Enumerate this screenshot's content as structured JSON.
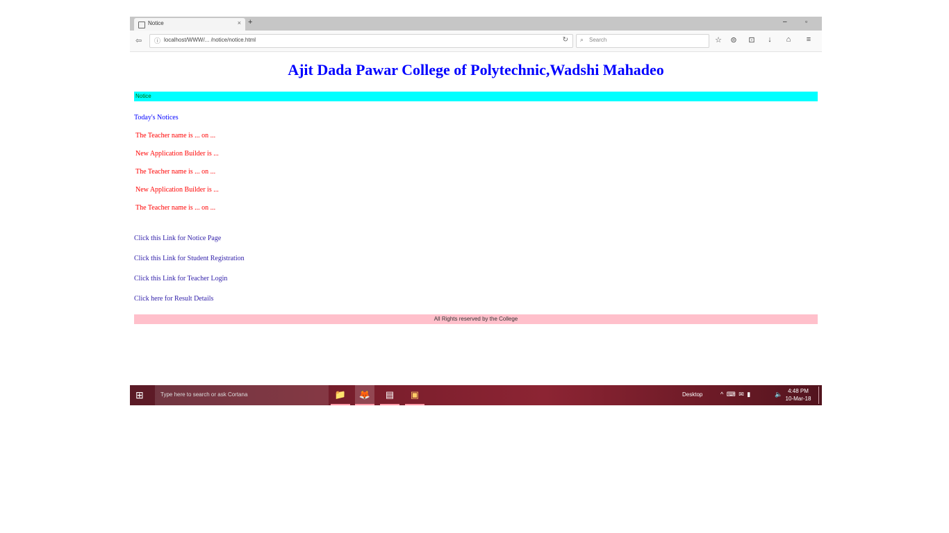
{
  "browser": {
    "tab_title": "Notice",
    "tab_close": "×",
    "new_tab": "+",
    "win_minimize": "–",
    "win_maximize": "▫",
    "back": "⇦",
    "info": "ⓘ",
    "url": "localhost/WWW/... /notice/notice.html",
    "reload": "↻",
    "search_icon": "⌕",
    "search_placeholder": "Search",
    "toolbar_icons": [
      "star-icon",
      "reading-list-icon",
      "pocket-icon",
      "download-icon",
      "home-icon",
      "menu-icon"
    ],
    "toolbar_glyphs": [
      "☆",
      "⊜",
      "⊡",
      "↓",
      "⌂",
      "≡"
    ]
  },
  "page": {
    "title": "Ajit Dada Pawar College of Polytechnic,Wadshi Mahadeo",
    "cyan_bar_text": "Notice",
    "notice_label": "Today's Notices",
    "notices": [
      "The Teacher name is ... on ...",
      "New Application Builder is ...",
      "The Teacher name is ... on ...",
      "New Application Builder is ...",
      "The Teacher name is ... on ..."
    ],
    "links": [
      "Click this Link for Notice Page",
      "Click this Link for Student Registration",
      "Click this Link for Teacher Login",
      "Click here for Result Details"
    ],
    "footer": "All Rights reserved by the College"
  },
  "taskbar": {
    "start_icon": "⊞",
    "search_text": "Type here to search or ask Cortana",
    "apps": [
      {
        "name": "file-explorer-icon",
        "glyph": "📁"
      },
      {
        "name": "firefox-icon",
        "glyph": "🦊"
      },
      {
        "name": "app-window-icon",
        "glyph": "▤"
      },
      {
        "name": "photos-icon",
        "glyph": "▣"
      }
    ],
    "tray_label": "Desktop",
    "tray_icons": "^ ⌨ ✉ ▮",
    "volume": "🔈",
    "time": "4:48 PM",
    "date": "10-Mar-18"
  },
  "colors": {
    "title": "#0000ff",
    "cyan_bar": "#00ffff",
    "notice_text": "#ff0000",
    "link_text": "#3322aa",
    "footer_bar": "#ffc0cb"
  }
}
